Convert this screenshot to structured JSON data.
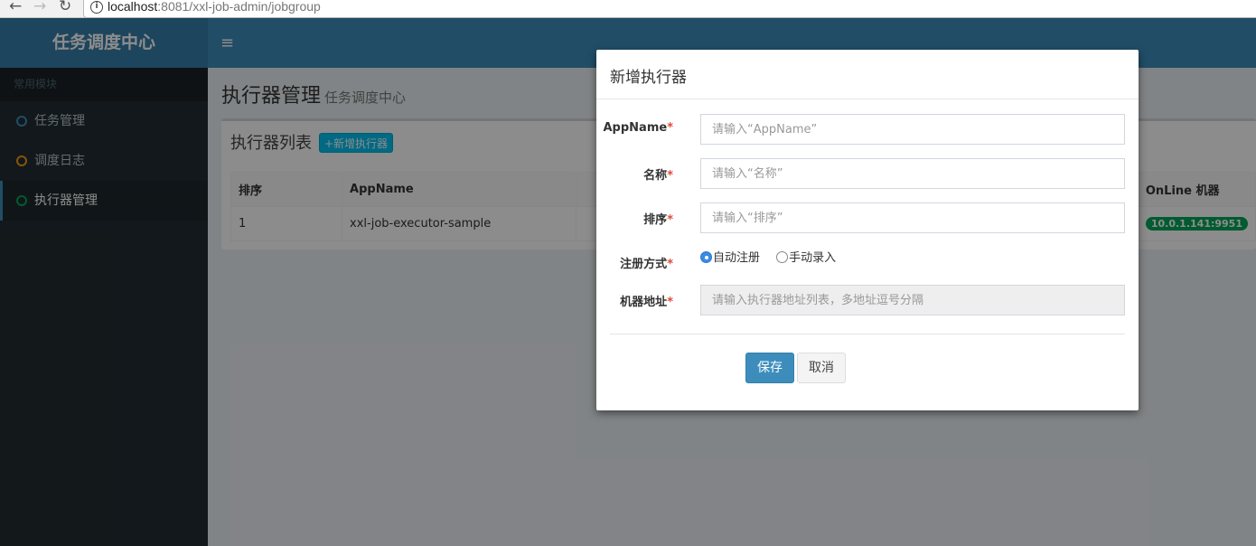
{
  "browser": {
    "back_icon": "←",
    "forward_icon": "→",
    "reload_icon": "↻",
    "url_host": "localhost",
    "url_path": ":8081/xxl-job-admin/jobgroup"
  },
  "sidebar": {
    "logo": "任务调度中心",
    "section_header": "常用模块",
    "items": [
      {
        "label": "任务管理",
        "icon_color": "#3c8dbc"
      },
      {
        "label": "调度日志",
        "icon_color": "#f39c12"
      },
      {
        "label": "执行器管理",
        "icon_color": "#00a65a"
      }
    ]
  },
  "header": {
    "menu_toggle": "≡"
  },
  "content": {
    "title": "执行器管理",
    "subtitle": "任务调度中心",
    "box_title": "执行器列表",
    "add_button": "+新增执行器",
    "table": {
      "columns": [
        "排序",
        "AppName",
        "",
        "OnLine 机器"
      ],
      "rows": [
        [
          "1",
          "xxl-job-executor-sample",
          "",
          "10.0.1.141:9951"
        ]
      ]
    }
  },
  "modal": {
    "title": "新增执行器",
    "fields": {
      "appname": {
        "label": "AppName",
        "placeholder": "请输入“AppName”"
      },
      "name": {
        "label": "名称",
        "placeholder": "请输入“名称”"
      },
      "order": {
        "label": "排序",
        "placeholder": "请输入“排序”"
      },
      "register_type": {
        "label": "注册方式",
        "options": [
          "自动注册",
          "手动录入"
        ],
        "selected": "自动注册"
      },
      "address": {
        "label": "机器地址",
        "placeholder": "请输入执行器地址列表，多地址逗号分隔"
      }
    },
    "required_mark": "*",
    "save_label": "保存",
    "cancel_label": "取消"
  }
}
